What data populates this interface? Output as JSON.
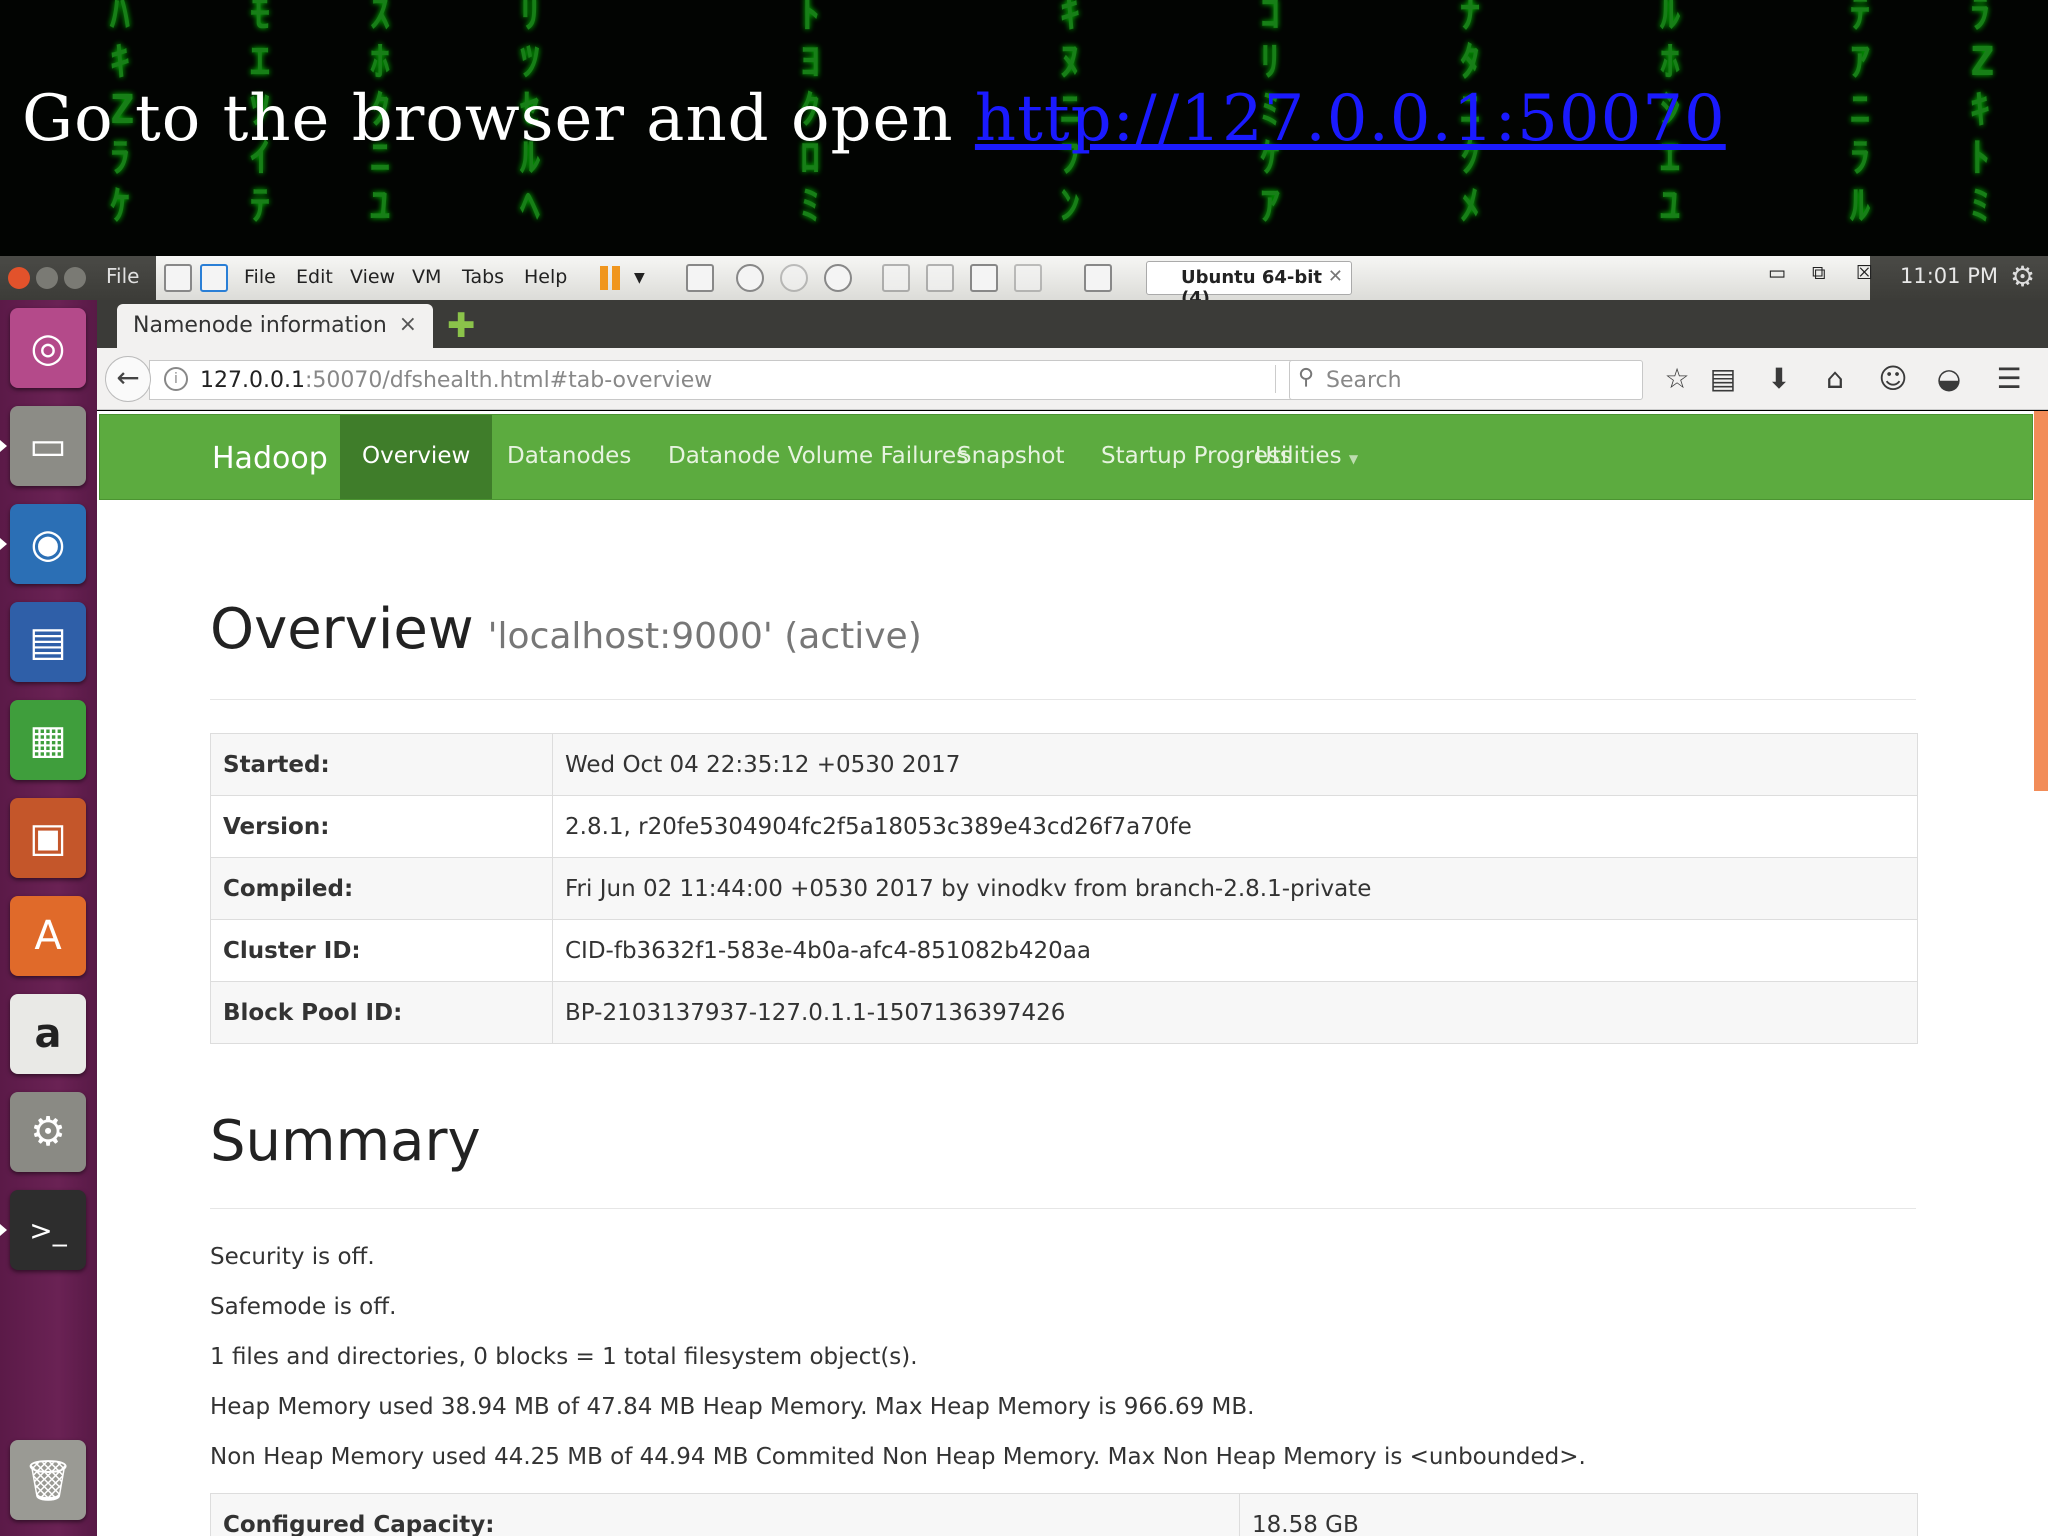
{
  "slide": {
    "title_prefix": "Go to the browser and open ",
    "title_link": "http://127.0.0.1:50070"
  },
  "vm": {
    "file_menu": "File",
    "menus": [
      "File",
      "Edit",
      "View",
      "VM",
      "Tabs",
      "Help"
    ],
    "tab_label": "Ubuntu 64-bit (4)",
    "clock": "11:01 PM"
  },
  "browser": {
    "tab_title": "Namenode information",
    "url_host": "127.0.0.1",
    "url_path": ":50070/dfshealth.html#tab-overview",
    "search_placeholder": "Search"
  },
  "navbar": {
    "brand": "Hadoop",
    "items": [
      "Overview",
      "Datanodes",
      "Datanode Volume Failures",
      "Snapshot",
      "Startup Progress",
      "Utilities"
    ]
  },
  "overview": {
    "heading": "Overview",
    "subheading": "'localhost:9000' (active)",
    "rows": [
      {
        "key": "Started:",
        "value": "Wed Oct 04 22:35:12 +0530 2017"
      },
      {
        "key": "Version:",
        "value": "2.8.1, r20fe5304904fc2f5a18053c389e43cd26f7a70fe"
      },
      {
        "key": "Compiled:",
        "value": "Fri Jun 02 11:44:00 +0530 2017 by vinodkv from branch-2.8.1-private"
      },
      {
        "key": "Cluster ID:",
        "value": "CID-fb3632f1-583e-4b0a-afc4-851082b420aa"
      },
      {
        "key": "Block Pool ID:",
        "value": "BP-2103137937-127.0.1.1-1507136397426"
      }
    ]
  },
  "summary": {
    "heading": "Summary",
    "lines": [
      "Security is off.",
      "Safemode is off.",
      "1 files and directories, 0 blocks = 1 total filesystem object(s).",
      "Heap Memory used 38.94 MB of 47.84 MB Heap Memory. Max Heap Memory is 966.69 MB.",
      "Non Heap Memory used 44.25 MB of 44.94 MB Commited Non Heap Memory. Max Non Heap Memory is <unbounded>."
    ],
    "capacity_key": "Configured Capacity:",
    "capacity_value": "18.58 GB"
  },
  "colors": {
    "hadoop_green": "#5cab3f",
    "active_tab": "#3f7d2a",
    "launcher_purple": "#6a2254"
  },
  "launcher_icons": [
    "ubuntu-dash-icon",
    "files-icon",
    "firefox-icon",
    "writer-icon",
    "calc-icon",
    "impress-icon",
    "software-center-icon",
    "amazon-icon",
    "settings-icon",
    "terminal-icon",
    "trash-icon"
  ]
}
